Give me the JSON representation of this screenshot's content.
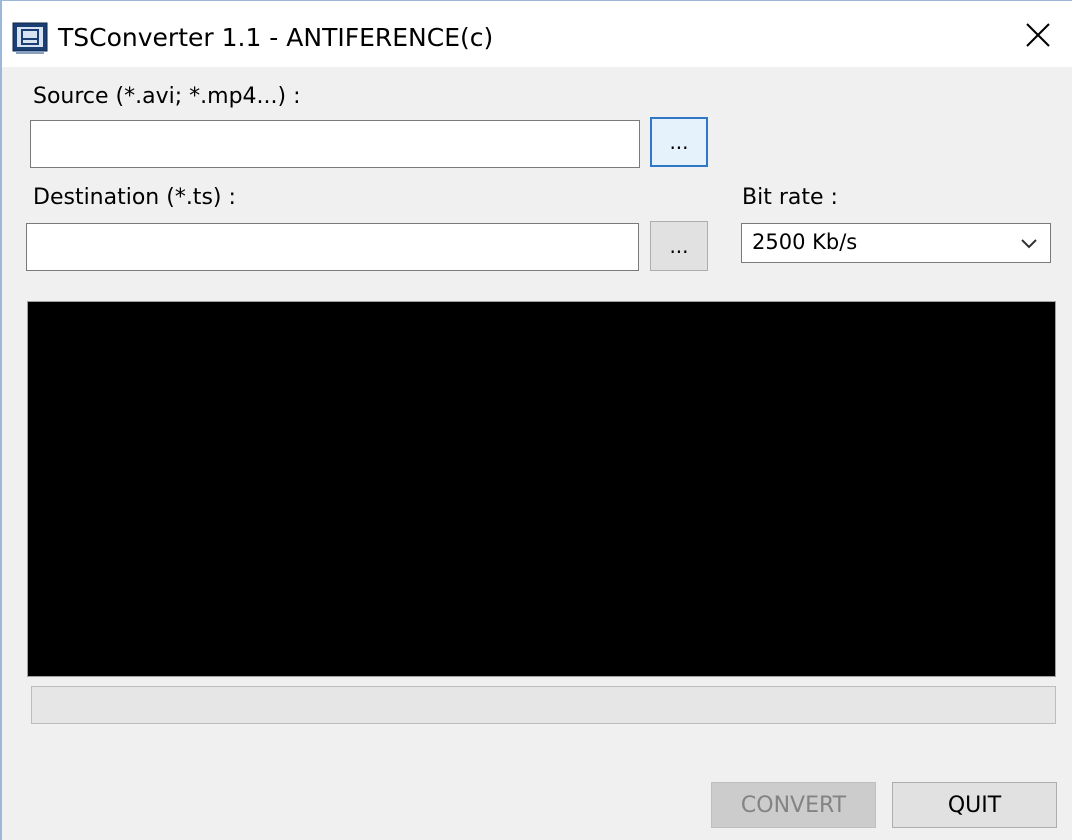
{
  "window": {
    "title": "TSConverter 1.1 - ANTIFERENCE(c)",
    "app_icon": "app-window-icon",
    "close_icon": "close-icon"
  },
  "source": {
    "label": "Source (*.avi; *.mp4...) :",
    "value": "",
    "browse_label": "..."
  },
  "destination": {
    "label": "Destination (*.ts) :",
    "value": "",
    "browse_label": "..."
  },
  "bitrate": {
    "label": "Bit rate :",
    "selected": "2500 Kb/s",
    "dropdown_icon": "chevron-down-icon"
  },
  "console": {
    "text": ""
  },
  "progress": {
    "percent": 0
  },
  "actions": {
    "convert_label": "CONVERT",
    "quit_label": "QUIT"
  },
  "colors": {
    "console_background": "#000000",
    "focus_border": "#2f77c9",
    "disabled_text": "#838383"
  }
}
